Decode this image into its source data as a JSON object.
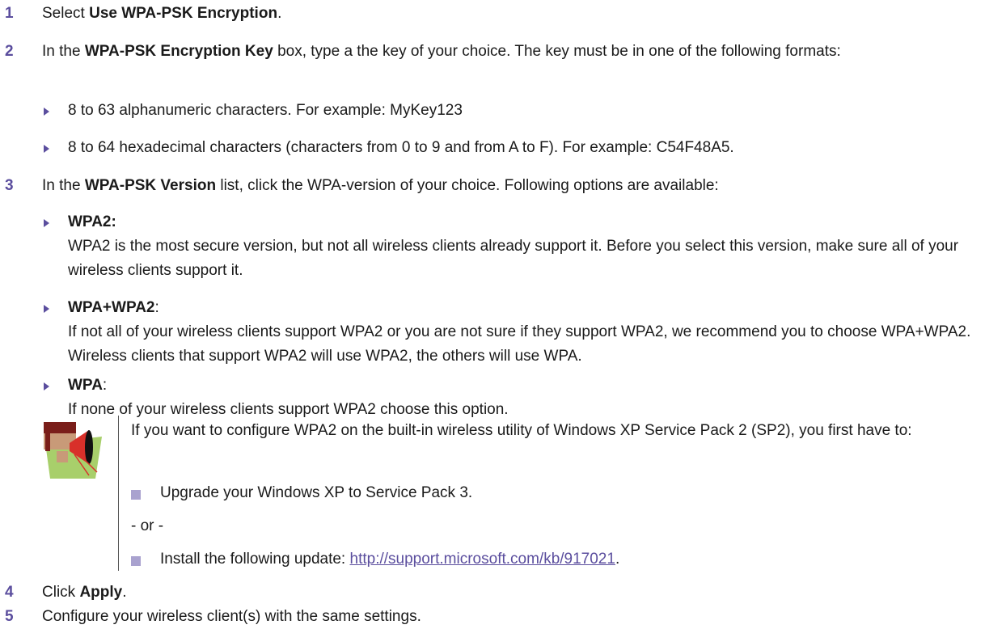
{
  "steps": [
    {
      "num": "1",
      "pre": "Select ",
      "bold": "Use WPA-PSK Encryption",
      "post": "."
    },
    {
      "num": "2",
      "pre": "In the ",
      "bold": "WPA-PSK Encryption Key",
      "post": " box, type a the key of your choice. The key must be in one of the following formats:"
    },
    {
      "num": "3",
      "pre": "In the ",
      "bold": "WPA-PSK Version",
      "post": " list, click the WPA-version of your choice. Following options are available:"
    },
    {
      "num": "4",
      "pre": "Click ",
      "bold": "Apply",
      "post": "."
    },
    {
      "num": "5",
      "pre": "Configure your wireless client(s) with the same settings.",
      "bold": "",
      "post": ""
    }
  ],
  "key_formats": [
    "8 to 63 alphanumeric characters. For example: MyKey123",
    "8 to 64 hexadecimal characters (characters from 0 to 9 and from A to F). For example: C54F48A5."
  ],
  "versions": [
    {
      "name": "WPA2",
      "colon": ":",
      "desc": "WPA2 is the most secure version, but not all wireless clients already support it. Before you select this version, make sure all of your wireless clients support it."
    },
    {
      "name": "WPA+WPA2",
      "colon": ":",
      "desc": "If not all of your wireless clients support WPA2 or you are not sure if they support WPA2, we recommend you to choose WPA+WPA2. Wireless clients that support WPA2 will use WPA2, the others will use WPA."
    },
    {
      "name": "WPA",
      "colon": ":",
      "desc": "If none of your wireless clients support WPA2 choose this option."
    }
  ],
  "note": {
    "intro": "If you want to configure WPA2 on the built-in wireless utility of Windows XP Service Pack 2 (SP2), you first have to:",
    "option1": "Upgrade your Windows XP to Service Pack 3.",
    "separator": "- or -",
    "option2_pre": "Install the following update: ",
    "option2_link": "http://support.microsoft.com/kb/917021",
    "option2_post": "."
  },
  "colors": {
    "accent": "#5b4e9e",
    "square": "#a9a2cf",
    "icon_green": "#a8cf6b",
    "icon_red": "#d8302a"
  }
}
